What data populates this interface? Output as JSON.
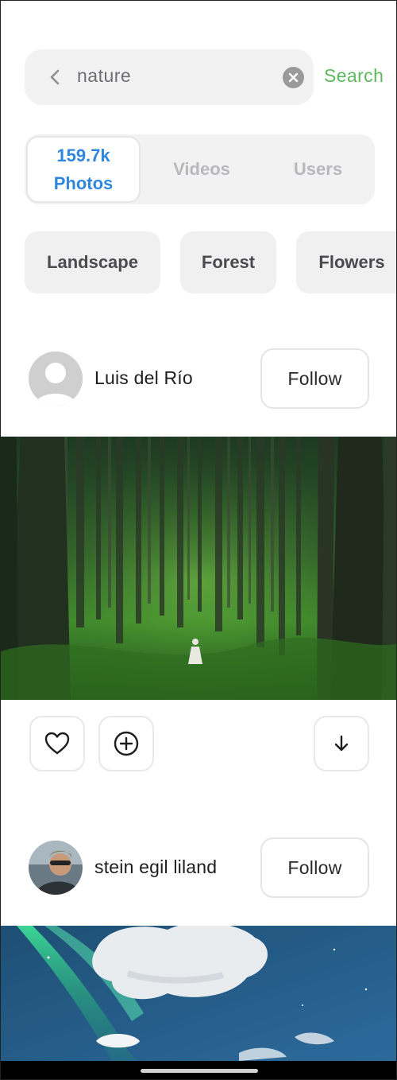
{
  "search": {
    "query": "nature",
    "action_label": "Search",
    "back_icon": "chevron-left-icon",
    "clear_icon": "clear-circle-icon"
  },
  "tabs": [
    {
      "count": "159.7k",
      "label": "Photos",
      "active": true
    },
    {
      "label": "Videos",
      "active": false
    },
    {
      "label": "Users",
      "active": false
    }
  ],
  "filters": [
    "Landscape",
    "Forest",
    "Flowers"
  ],
  "posts": [
    {
      "user": "Luis del Río",
      "avatar": "default-avatar-icon",
      "follow_label": "Follow",
      "photo": "forest-with-person-photo"
    },
    {
      "user": "stein egil liland",
      "avatar": "user-photo-avatar",
      "follow_label": "Follow",
      "photo": "aurora-sky-photo"
    }
  ],
  "actions": {
    "like_icon": "heart-icon",
    "add_icon": "plus-circle-icon",
    "download_icon": "download-arrow-icon"
  },
  "colors": {
    "accent_blue": "#2e86de",
    "search_green": "#5cb85c",
    "inactive_tab": "#b8b8bd",
    "chip_bg": "#f0f0f0"
  }
}
